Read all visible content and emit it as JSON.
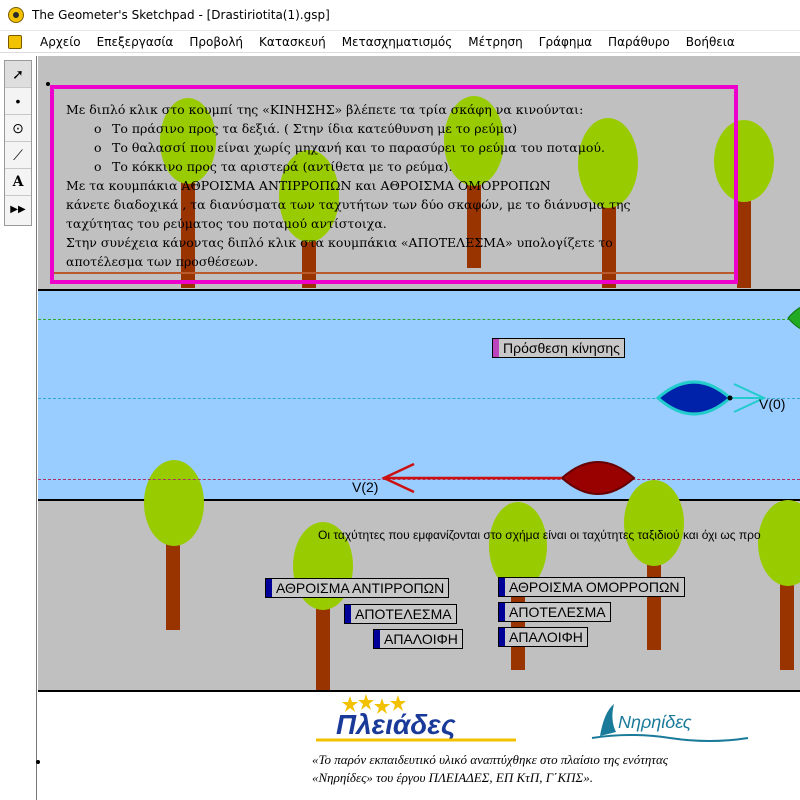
{
  "window": {
    "title": "The Geometer's Sketchpad - [Drastiriotita(1).gsp]"
  },
  "menu": [
    "Αρχείο",
    "Επεξεργασία",
    "Προβολή",
    "Κατασκευή",
    "Μετασχηματισμός",
    "Μέτρηση",
    "Γράφημα",
    "Παράθυρο",
    "Βοήθεια"
  ],
  "toolbox": [
    {
      "icon": "arrow-select-icon",
      "glyph": "➚"
    },
    {
      "icon": "point-tool-icon",
      "glyph": "•"
    },
    {
      "icon": "compass-tool-icon",
      "glyph": "⊙"
    },
    {
      "icon": "straightedge-tool-icon",
      "glyph": "⟋"
    },
    {
      "icon": "text-tool-icon",
      "glyph": "A"
    },
    {
      "icon": "custom-tool-icon",
      "glyph": "▶▶"
    }
  ],
  "instructions": {
    "line1": "Με διπλό κλικ στο κουμπί της «ΚΙΝΗΣΗΣ» βλέπετε τα τρία σκάφη  να κινούνται:",
    "bullet_mark": "o",
    "bullet1": "Το πράσινο προς τα δεξιά. ( Στην ίδια κατεύθυνση με το ρεύμα)",
    "bullet2": "Το  θαλασσί που είναι χωρίς μηχανή και το παρασύρει το ρεύμα του ποταμού.",
    "bullet3": "Το κόκκινο προς τα αριστερά (αντίθετα με το ρεύμα).",
    "line5": "Με τα κουμπάκια ΑΘΡΟΙΣΜΑ ΑΝΤΙΡΡΟΠΩΝ  και ΑΘΡΟΙΣΜΑ ΟΜΟΡΡΟΠΩΝ",
    "line6": "κάνετε διαδοχικά , τα διανύσματα των ταχυτήτων των δύο σκαφών, με το διάνυσμα της",
    "line7": "ταχύτητας του ρεύματος του ποταμού αντίστοιχα.",
    "line8": " Στην συνέχεια κάνοντας διπλό κλικ στα κουμπάκια «ΑΠΟΤΕΛΕΣΜΑ» υπολογίζετε το",
    "line9": "αποτέλεσμα των προσθέσεων."
  },
  "buttons": {
    "motion": "Πρόσθεση  κίνησης",
    "sum_opposite": "ΑΘΡΟΙΣΜΑ ΑΝΤΙΡΡΟΠΩΝ",
    "result_left": "ΑΠΟΤΕΛΕΣΜΑ",
    "clear_left": "ΑΠΑΛΟΙΦΗ",
    "sum_same": "ΑΘΡΟΙΣΜΑ ΟΜΟΡΡΟΠΩΝ",
    "result_right": "ΑΠΟΤΕΛΕΣΜΑ",
    "clear_right": "ΑΠΑΛΟΙΦΗ"
  },
  "labels": {
    "v0": "V(0)",
    "v2": "V(2)",
    "info": "Οι ταχύτητες που εμφανίζονται στο σχήμα είναι οι ταχύτητες ταξιδιού και όχι ως προ"
  },
  "footer": {
    "logo1_text": "Πλειάδες",
    "logo2_text": "Νηρηίδες",
    "line1": "«Το παρόν εκπαιδευτικό υλικό αναπτύχθηκε στο πλαίσιο της ενότητας",
    "line2": "«Νηρηίδες» του έργου ΠΛΕΙΑΔΕΣ, ΕΠ ΚτΠ, Γ΄ΚΠΣ»."
  },
  "colors": {
    "river": "#99ccff",
    "bank": "#c0c0c0",
    "tree_crown": "#99cc00",
    "tree_trunk": "#993300",
    "frame": "#ee00cc",
    "boat_blue": "#0022aa",
    "boat_red": "#990000",
    "arrow_cyan": "#22cccc",
    "arrow_red": "#cc1111"
  }
}
